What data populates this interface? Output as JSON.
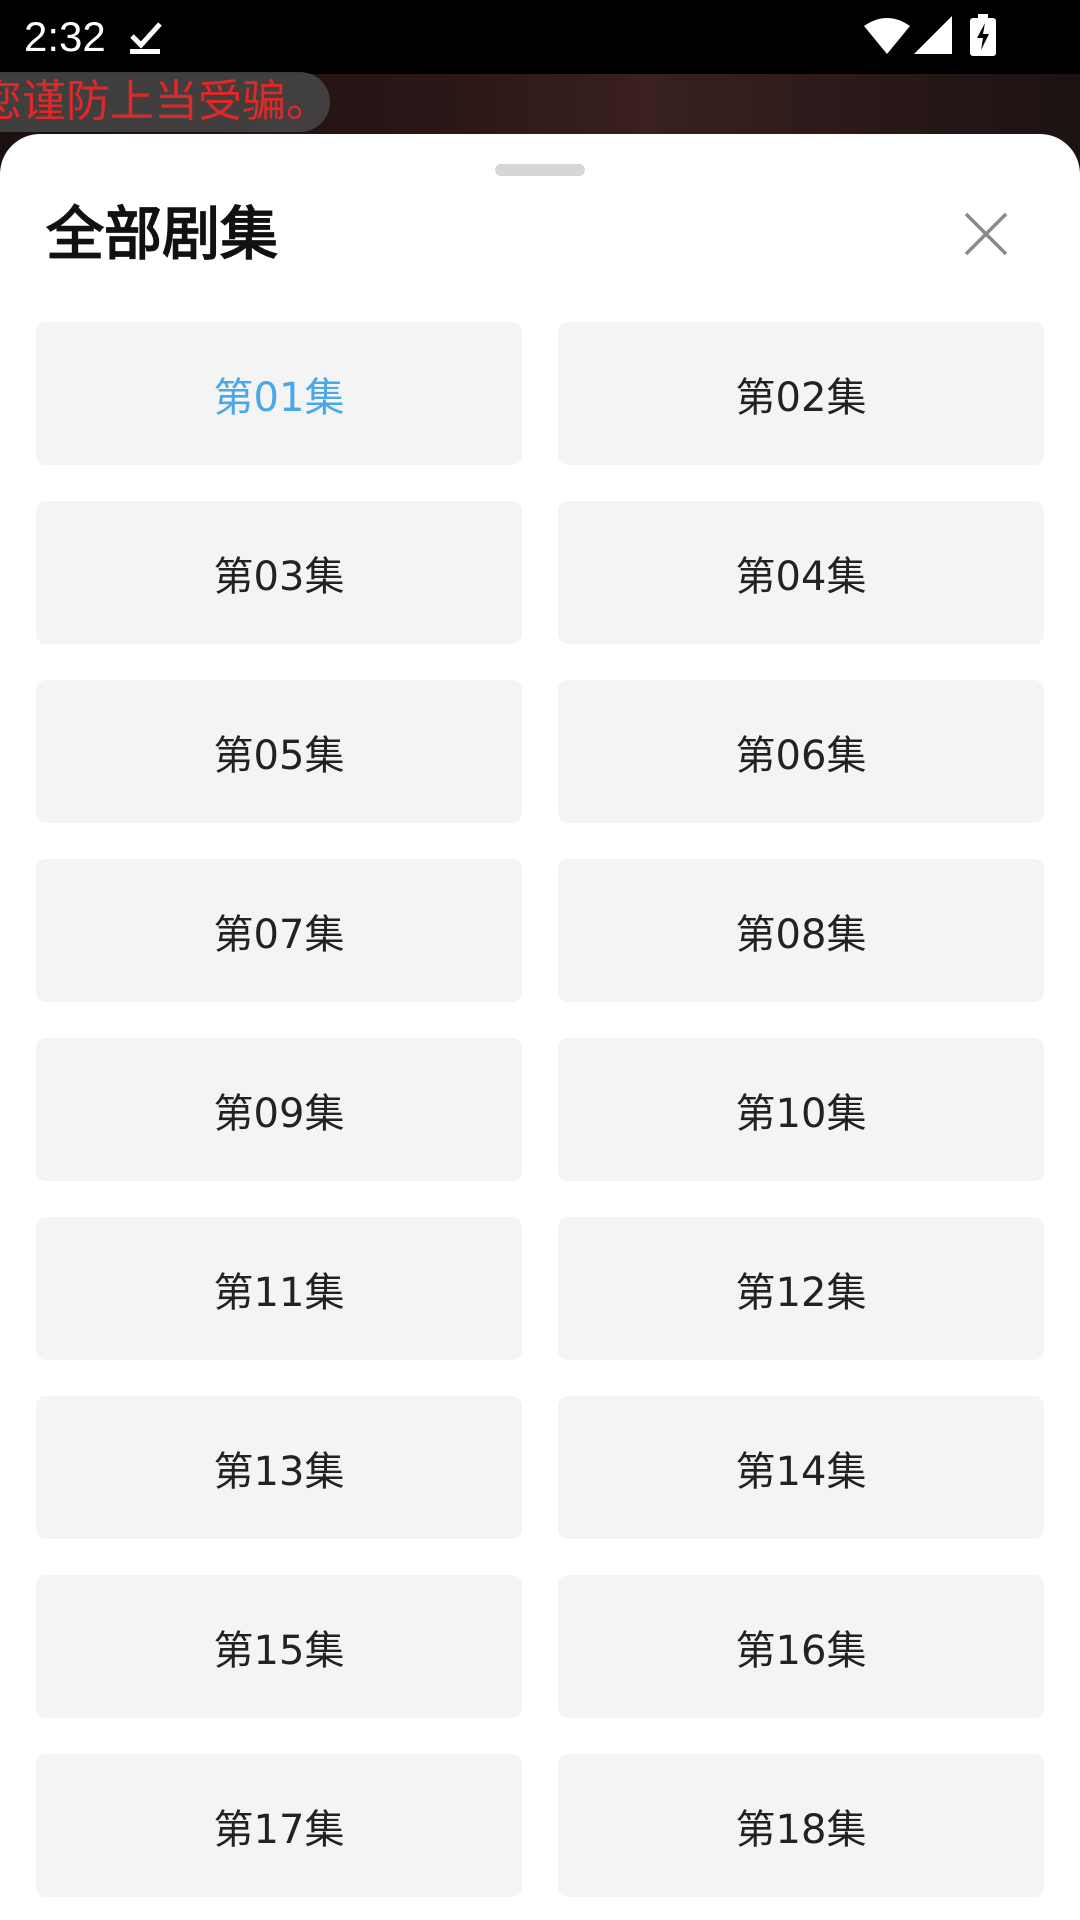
{
  "status_bar": {
    "time": "2:32",
    "icons": [
      "download-done-icon",
      "wifi-icon",
      "signal-icon",
      "battery-charging-icon"
    ]
  },
  "background": {
    "marquee_text": "您谨防上当受骗。"
  },
  "sheet": {
    "title": "全部剧集",
    "close_icon": "close-icon",
    "active_color": "#4aa8e8",
    "episodes": [
      {
        "label": "第01集",
        "active": true
      },
      {
        "label": "第02集",
        "active": false
      },
      {
        "label": "第03集",
        "active": false
      },
      {
        "label": "第04集",
        "active": false
      },
      {
        "label": "第05集",
        "active": false
      },
      {
        "label": "第06集",
        "active": false
      },
      {
        "label": "第07集",
        "active": false
      },
      {
        "label": "第08集",
        "active": false
      },
      {
        "label": "第09集",
        "active": false
      },
      {
        "label": "第10集",
        "active": false
      },
      {
        "label": "第11集",
        "active": false
      },
      {
        "label": "第12集",
        "active": false
      },
      {
        "label": "第13集",
        "active": false
      },
      {
        "label": "第14集",
        "active": false
      },
      {
        "label": "第15集",
        "active": false
      },
      {
        "label": "第16集",
        "active": false
      },
      {
        "label": "第17集",
        "active": false
      },
      {
        "label": "第18集",
        "active": false
      }
    ]
  }
}
